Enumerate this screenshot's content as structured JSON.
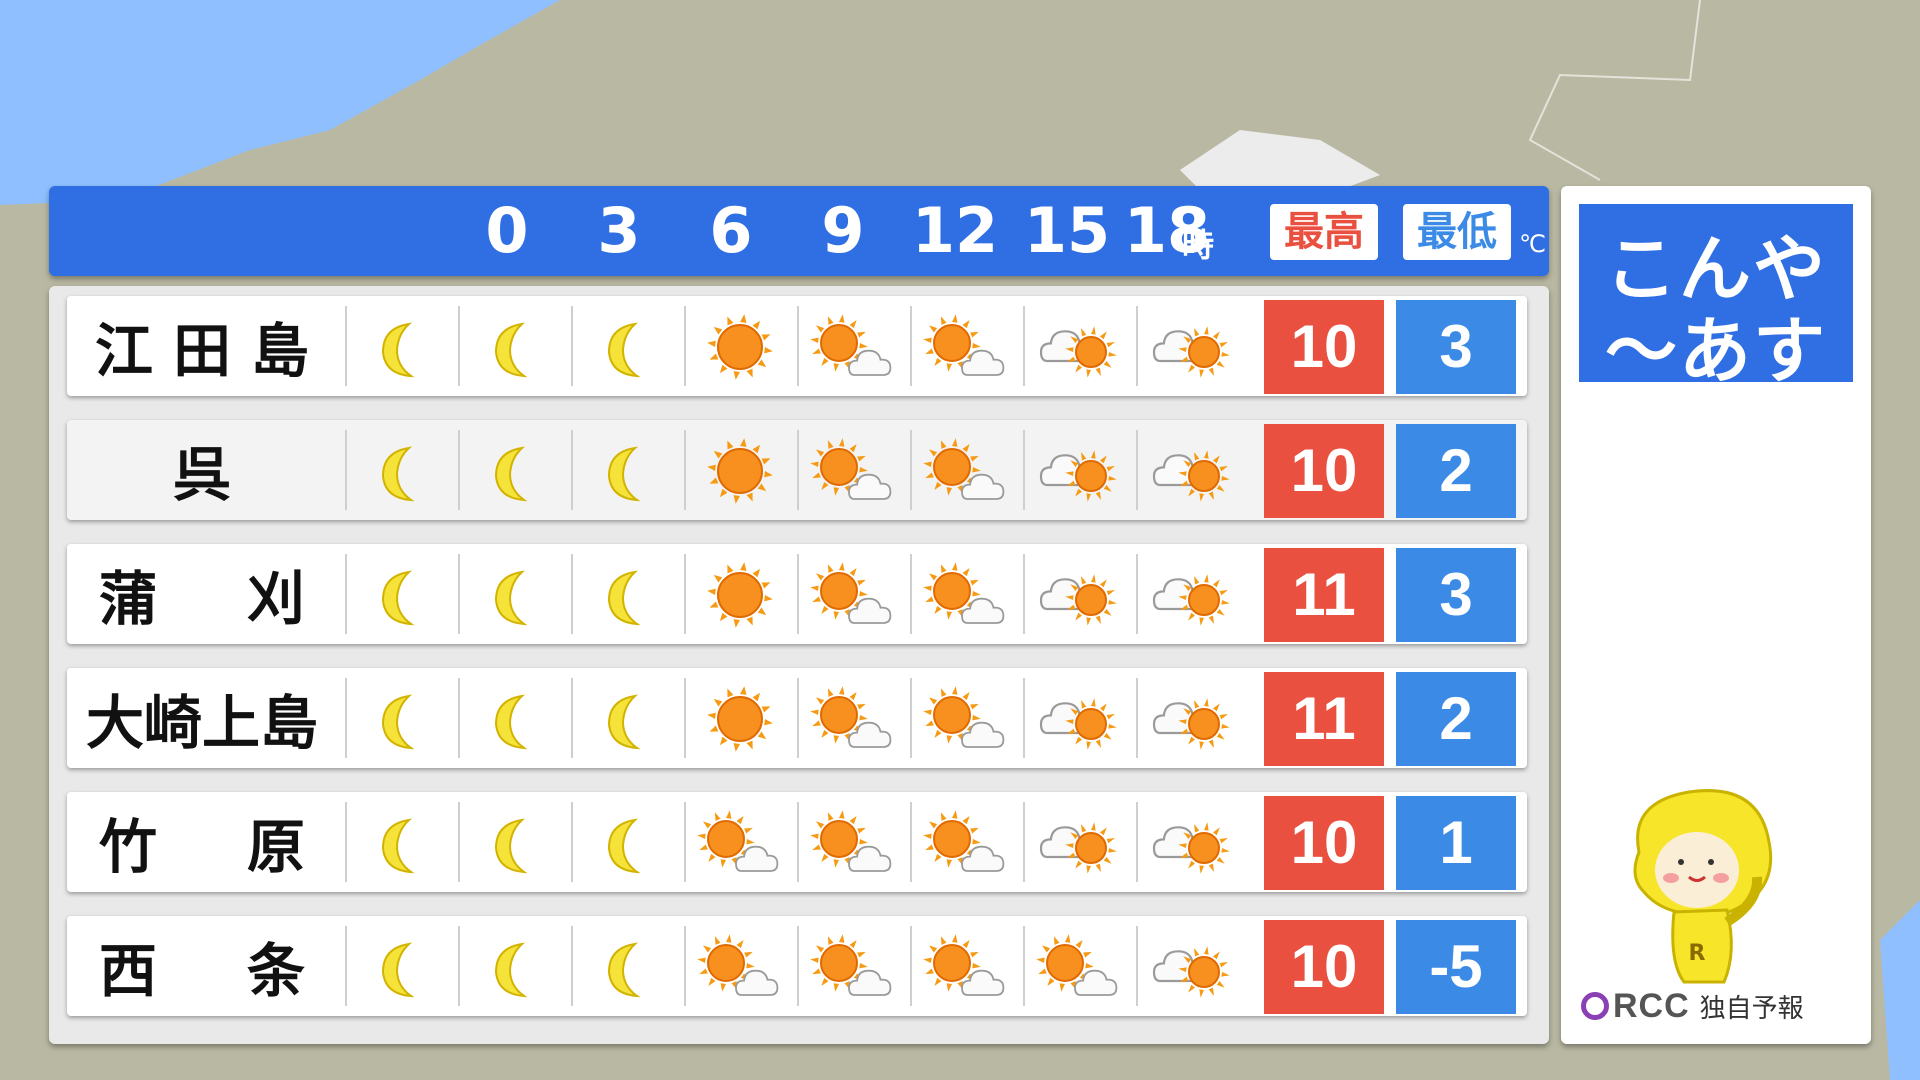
{
  "header": {
    "hours": [
      "0",
      "3",
      "6",
      "9",
      "12",
      "15",
      "18"
    ],
    "hour_unit": "時",
    "max_label": "最高",
    "min_label": "最低",
    "temp_unit": "℃"
  },
  "colors": {
    "header": "#2f6fe3",
    "max": "#e9503f",
    "min": "#3b8be6"
  },
  "rows": [
    {
      "place": [
        "江",
        "田",
        "島"
      ],
      "icons": [
        "moon",
        "moon",
        "moon",
        "sun",
        "sun-cloud",
        "sun-cloud",
        "cloud-sun",
        "cloud-sun"
      ],
      "max": "10",
      "min": "3"
    },
    {
      "place": [
        "呉"
      ],
      "icons": [
        "moon",
        "moon",
        "moon",
        "sun",
        "sun-cloud",
        "sun-cloud",
        "cloud-sun",
        "cloud-sun"
      ],
      "max": "10",
      "min": "2"
    },
    {
      "place": [
        "蒲",
        "刈"
      ],
      "icons": [
        "moon",
        "moon",
        "moon",
        "sun",
        "sun-cloud",
        "sun-cloud",
        "cloud-sun",
        "cloud-sun"
      ],
      "max": "11",
      "min": "3"
    },
    {
      "place": [
        "大崎上島"
      ],
      "icons": [
        "moon",
        "moon",
        "moon",
        "sun",
        "sun-cloud",
        "sun-cloud",
        "cloud-sun",
        "cloud-sun"
      ],
      "max": "11",
      "min": "2"
    },
    {
      "place": [
        "竹",
        "原"
      ],
      "icons": [
        "moon",
        "moon",
        "moon",
        "sun-cloud",
        "sun-cloud",
        "sun-cloud",
        "cloud-sun",
        "cloud-sun"
      ],
      "max": "10",
      "min": "1"
    },
    {
      "place": [
        "西",
        "条"
      ],
      "icons": [
        "moon",
        "moon",
        "moon",
        "sun-cloud",
        "sun-cloud",
        "sun-cloud",
        "sun-cloud",
        "cloud-sun"
      ],
      "max": "10",
      "min": "-5"
    }
  ],
  "side": {
    "title_lines": [
      "こんや",
      "〜あす"
    ],
    "mascot": "lemon-mascot-icon",
    "brand": "RCC",
    "brand_tag": "独自予報"
  }
}
